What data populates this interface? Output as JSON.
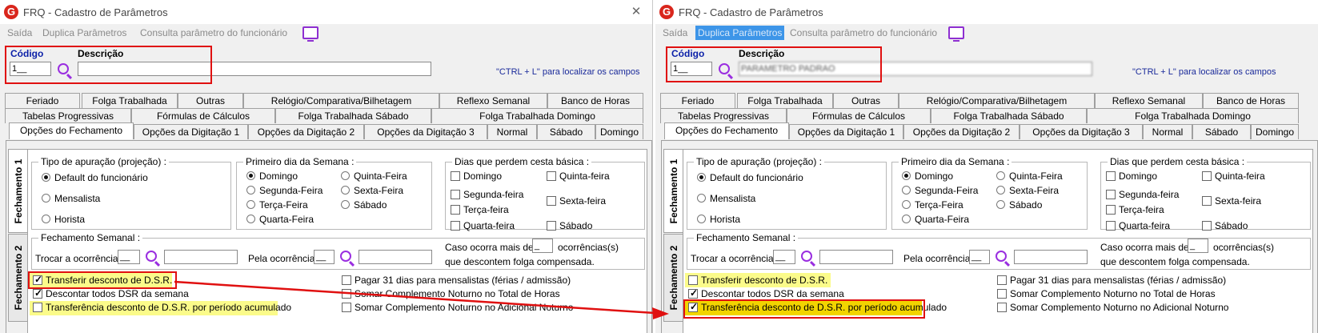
{
  "windows": [
    {
      "title": "FRQ - Cadastro de Parâmetros",
      "close_glyph": "✕",
      "menu": [
        "Saída",
        "Duplica Parâmetros",
        "Consulta parâmetro do funcionário"
      ],
      "menu_highlight": -1,
      "codigo_label": "Código",
      "codigo_value": "1__",
      "descricao_label": "Descrição",
      "descricao_value": "",
      "ctrl_hint": "\"CTRL + L\" para localizar os campos",
      "tab_rows": [
        [
          "Feriado",
          "Folga Trabalhada",
          "Outras",
          "Relógio/Comparativa/Bilhetagem",
          "Reflexo Semanal",
          "Banco de Horas"
        ],
        [
          "Tabelas Progressivas",
          "Fórmulas de Cálculos",
          "Folga Trabalhada Sábado",
          "Folga Trabalhada Domingo"
        ],
        [
          "Opções do Fechamento",
          "Opções da Digitação 1",
          "Opções da Digitação 2",
          "Opções da Digitação 3",
          "Normal",
          "Sábado",
          "Domingo"
        ]
      ],
      "vtabs": [
        "Fechamento 1",
        "Fechamento 2"
      ],
      "tipo_group": {
        "title": "Tipo de apuração (projeção) :",
        "options": [
          "Default do funcionário",
          "Mensalista",
          "Horista"
        ],
        "selected": 0
      },
      "semana_group": {
        "title": "Primeiro dia da Semana :",
        "options": [
          "Domingo",
          "Segunda-Feira",
          "Terça-Feira",
          "Quarta-Feira",
          "Quinta-Feira",
          "Sexta-Feira",
          "Sábado"
        ],
        "selected": 0
      },
      "cesta_group": {
        "title": "Dias que perdem cesta básica :",
        "options": [
          "Domingo",
          "Segunda-feira",
          "Terça-feira",
          "Quarta-feira",
          "Quinta-feira",
          "Sexta-feira",
          "Sábado"
        ]
      },
      "fechamento_semanal": {
        "title": "Fechamento Semanal :",
        "trocar_label": "Trocar a ocorrência:",
        "trocar_value": "__",
        "pela_label": "Pela ocorrência:",
        "pela_value": "__",
        "caso_label": "Caso ocorra mais de",
        "caso_value": "_",
        "ocorrencias_label": "ocorrências(s)",
        "folga_label": "que descontem folga compensada."
      },
      "checks": [
        {
          "label": "Transferir desconto de D.S.R.",
          "checked": true
        },
        {
          "label": "Descontar todos DSR da semana",
          "checked": true
        },
        {
          "label": "Transferência desconto de D.S.R. por período acumulado",
          "checked": false
        },
        {
          "label": "Pagar 31 dias para mensalistas (férias / admissão)",
          "checked": false
        },
        {
          "label": "Somar Complemento Noturno no Total de Horas",
          "checked": false
        },
        {
          "label": "Somar Complemento Noturno no Adicional Noturno",
          "checked": false
        }
      ]
    },
    {
      "title": "FRQ - Cadastro de Parâmetros",
      "close_glyph": "",
      "menu": [
        "Saída",
        "Duplica Parâmetros",
        "Consulta parâmetro do funcionário"
      ],
      "menu_highlight": 1,
      "codigo_label": "Código",
      "codigo_value": "1__",
      "descricao_label": "Descrição",
      "descricao_value": "PARAMETRO PADRAO",
      "ctrl_hint": "\"CTRL + L\" para localizar os campos",
      "tab_rows": [
        [
          "Feriado",
          "Folga Trabalhada",
          "Outras",
          "Relógio/Comparativa/Bilhetagem",
          "Reflexo Semanal",
          "Banco de Horas"
        ],
        [
          "Tabelas Progressivas",
          "Fórmulas de Cálculos",
          "Folga Trabalhada Sábado",
          "Folga Trabalhada Domingo"
        ],
        [
          "Opções do Fechamento",
          "Opções da Digitação 1",
          "Opções da Digitação 2",
          "Opções da Digitação 3",
          "Normal",
          "Sábado",
          "Domingo"
        ]
      ],
      "vtabs": [
        "Fechamento 1",
        "Fechamento 2"
      ],
      "tipo_group": {
        "title": "Tipo de apuração (projeção) :",
        "options": [
          "Default do funcionário",
          "Mensalista",
          "Horista"
        ],
        "selected": 0
      },
      "semana_group": {
        "title": "Primeiro dia da Semana :",
        "options": [
          "Domingo",
          "Segunda-Feira",
          "Terça-Feira",
          "Quarta-Feira",
          "Quinta-Feira",
          "Sexta-Feira",
          "Sábado"
        ],
        "selected": 0
      },
      "cesta_group": {
        "title": "Dias que perdem cesta básica :",
        "options": [
          "Domingo",
          "Segunda-feira",
          "Terça-feira",
          "Quarta-feira",
          "Quinta-feira",
          "Sexta-feira",
          "Sábado"
        ]
      },
      "fechamento_semanal": {
        "title": "Fechamento Semanal :",
        "trocar_label": "Trocar a ocorrência:",
        "trocar_value": "__",
        "pela_label": "Pela ocorrência:",
        "pela_value": "__",
        "caso_label": "Caso ocorra mais de",
        "caso_value": "_",
        "ocorrencias_label": "ocorrências(s)",
        "folga_label": "que descontem folga compensada."
      },
      "checks": [
        {
          "label": "Transferir desconto de D.S.R.",
          "checked": false
        },
        {
          "label": "Descontar todos DSR da semana",
          "checked": true
        },
        {
          "label": "Transferência desconto de D.S.R. por período acumulado",
          "checked": true
        },
        {
          "label": "Pagar 31 dias para mensalistas (férias / admissão)",
          "checked": false
        },
        {
          "label": "Somar Complemento Noturno no Total de Horas",
          "checked": false
        },
        {
          "label": "Somar Complemento Noturno no Adicional Noturno",
          "checked": false
        }
      ]
    }
  ],
  "colors": {
    "accent_red": "#e01010",
    "highlight_yellow": "#fbfb8a",
    "selected_yellow": "#f2d400",
    "menu_highlight": "#3d95e8",
    "search_purple": "#9a2ee0"
  },
  "icons": {
    "logo": "app-logo-icon",
    "search": "search-icon",
    "monitor": "monitor-icon",
    "close": "close-icon"
  }
}
